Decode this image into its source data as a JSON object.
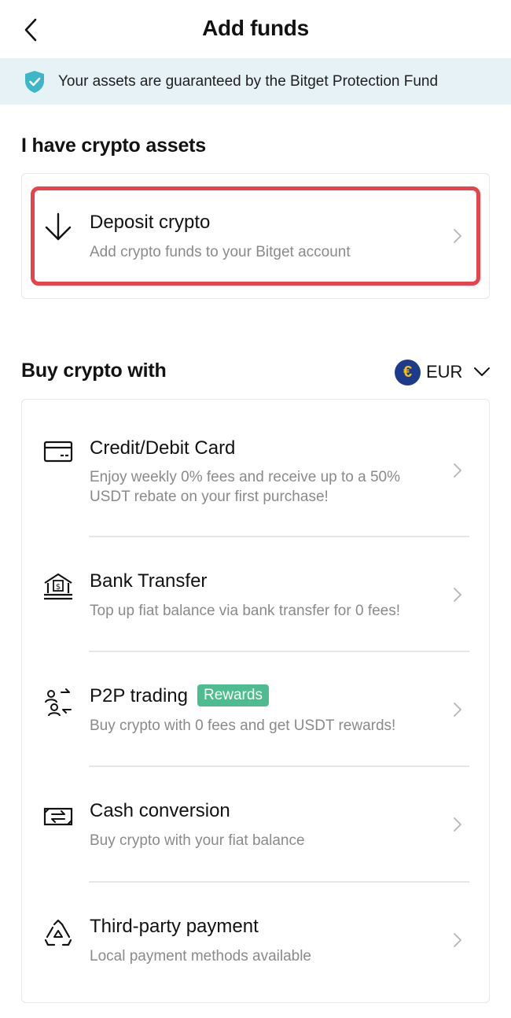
{
  "header": {
    "title": "Add funds"
  },
  "banner": {
    "text": "Your assets are guaranteed by the Bitget Protection Fund"
  },
  "crypto_section": {
    "title": "I have crypto assets",
    "deposit": {
      "title": "Deposit crypto",
      "desc": "Add crypto funds to your Bitget account"
    }
  },
  "buy_section": {
    "title": "Buy crypto with",
    "currency": {
      "symbol": "€",
      "code": "EUR"
    },
    "options": [
      {
        "title": "Credit/Debit Card",
        "desc": "Enjoy weekly 0% fees and receive up to a 50% USDT rebate on your first purchase!",
        "icon": "credit-card-icon"
      },
      {
        "title": "Bank Transfer",
        "desc": "Top up fiat balance via bank transfer for 0 fees!",
        "icon": "bank-icon"
      },
      {
        "title": "P2P trading",
        "badge": "Rewards",
        "desc": "Buy crypto with 0 fees and get USDT rewards!",
        "icon": "p2p-icon"
      },
      {
        "title": "Cash conversion",
        "desc": "Buy crypto with your fiat balance",
        "icon": "cash-conversion-icon"
      },
      {
        "title": "Third-party payment",
        "desc": "Local payment methods available",
        "icon": "third-party-icon"
      }
    ]
  },
  "colors": {
    "highlight": "#e8424a",
    "badge": "#4dbd91",
    "banner_bg": "#e7f2f6",
    "shield": "#3db6c8"
  }
}
